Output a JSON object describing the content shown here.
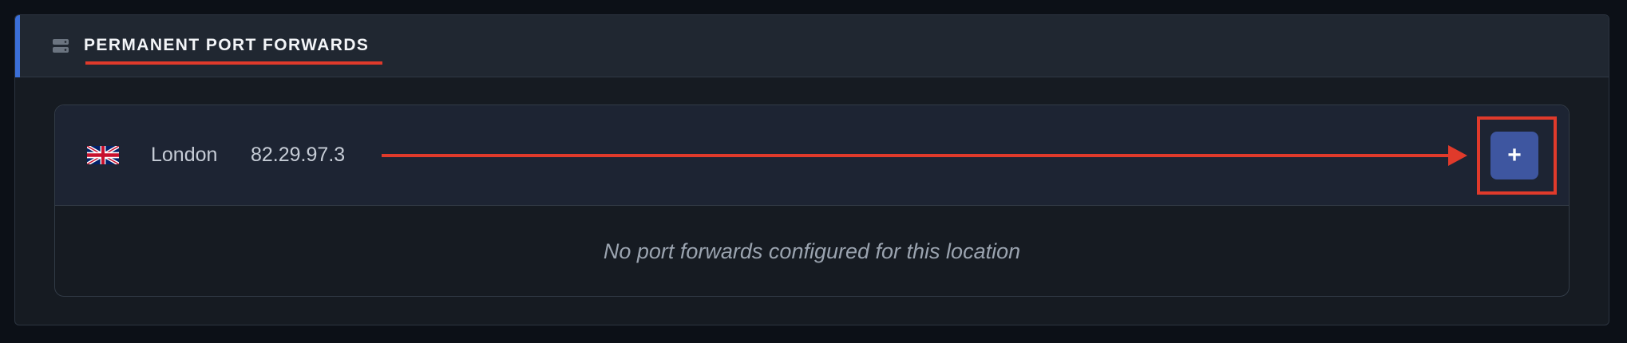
{
  "section": {
    "title": "PERMANENT PORT FORWARDS",
    "icon": "server-stack-icon",
    "accent_color": "#3b6fd8",
    "annotation_color": "#e03a2b"
  },
  "location": {
    "flag_icon": "uk-flag-icon",
    "name": "London",
    "ip": "82.29.97.3",
    "add_label": "+",
    "add_button_color": "#3e56a0",
    "empty_message": "No port forwards configured for this location"
  }
}
